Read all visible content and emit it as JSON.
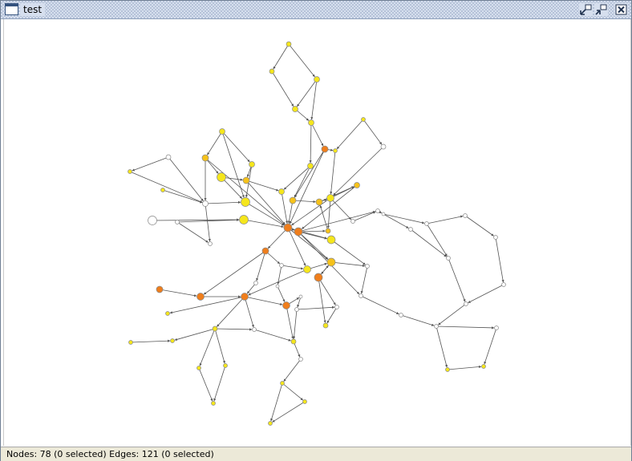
{
  "window": {
    "title": "test"
  },
  "statusbar": {
    "text": "Nodes: 78 (0 selected) Edges: 121 (0 selected)"
  },
  "icons": {
    "window": "window-icon",
    "minimize": "minimize-icon",
    "maximize": "maximize-icon",
    "close": "close-icon"
  },
  "colors": {
    "node_white": "#ffffff",
    "node_yellow": "#f5e61c",
    "node_gold": "#f6c21a",
    "node_orange": "#ef7e1c",
    "edge": "#555555"
  }
}
